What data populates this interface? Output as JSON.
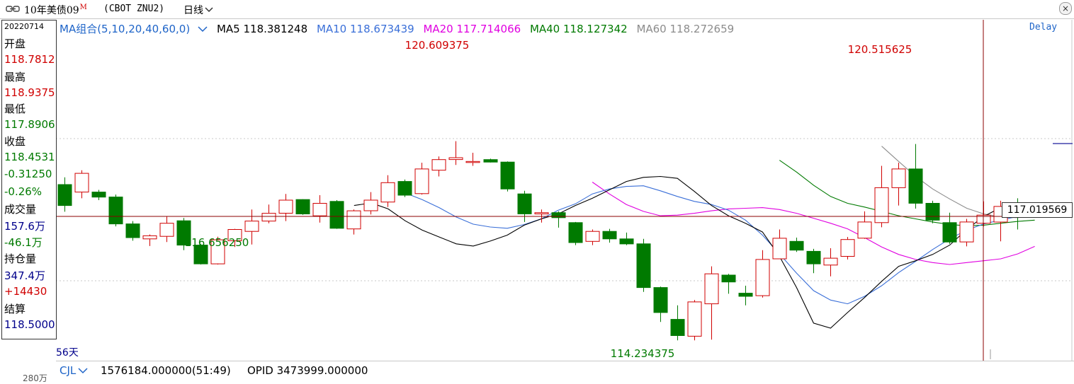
{
  "title_bar": {
    "instrument": "10年美债09",
    "marker": "M",
    "exchange": "(CBOT ZNU2)",
    "period": "日线",
    "window_button": "×"
  },
  "side_panel": {
    "date": "20220714",
    "open_label": "开盘",
    "open": "118.7812",
    "high_label": "最高",
    "high": "118.9375",
    "low_label": "最低",
    "low": "117.8906",
    "close_label": "收盘",
    "close": "118.4531",
    "change": "-0.31250",
    "change_pct": "-0.26%",
    "volume_label": "成交量",
    "volume": "157.6万",
    "volume_change": "-46.1万",
    "oi_label": "持仓量",
    "oi": "347.4万",
    "oi_change": "+14430",
    "settle_label": "结算",
    "settle": "118.5000"
  },
  "days_label": "56天",
  "ma_legend": {
    "group": "MA组合(5,10,20,40,60,0)",
    "ma5": "MA5 118.381248",
    "ma10": "MA10 118.673439",
    "ma20": "MA20 117.714066",
    "ma40": "MA40 118.127342",
    "ma60": "MA60 118.272659"
  },
  "delay_label": "Delay",
  "price_tag": "117.019569",
  "annotations": {
    "high1": "120.609375",
    "high2": "120.515625",
    "low1": "116.656250",
    "low2": "114.234375"
  },
  "volume_bar": {
    "indicator": "CJL",
    "volume_text": "1576184.000000(51:49)",
    "opid_text": "OPID 3473999.000000",
    "axis_label": "280万"
  },
  "colors": {
    "up": "#d00000",
    "down": "#007a00",
    "ma5": "#000000",
    "ma10": "#3a6fd8",
    "ma20": "#e000e0",
    "ma40": "#007a00",
    "ma60": "#8c8c8c",
    "axis_blue": "#1e64c8",
    "crosshair": "#8b0000"
  },
  "chart_data": {
    "type": "candlestick",
    "ylim": [
      114.0,
      121.0
    ],
    "candles": [
      {
        "o": 119.22,
        "h": 119.45,
        "l": 118.35,
        "c": 118.55
      },
      {
        "o": 118.98,
        "h": 119.68,
        "l": 118.78,
        "c": 119.58
      },
      {
        "o": 118.98,
        "h": 119.05,
        "l": 118.72,
        "c": 118.82
      },
      {
        "o": 118.82,
        "h": 118.9,
        "l": 117.88,
        "c": 117.96
      },
      {
        "o": 117.96,
        "h": 118.05,
        "l": 117.42,
        "c": 117.52
      },
      {
        "o": 117.48,
        "h": 117.62,
        "l": 117.25,
        "c": 117.58
      },
      {
        "o": 117.56,
        "h": 118.2,
        "l": 117.38,
        "c": 117.98
      },
      {
        "o": 118.06,
        "h": 118.15,
        "l": 117.12,
        "c": 117.28
      },
      {
        "o": 117.28,
        "h": 117.32,
        "l": 116.66,
        "c": 116.68
      },
      {
        "o": 116.68,
        "h": 117.55,
        "l": 116.66,
        "c": 117.45
      },
      {
        "o": 117.42,
        "h": 117.8,
        "l": 117.22,
        "c": 117.78
      },
      {
        "o": 117.72,
        "h": 118.42,
        "l": 117.3,
        "c": 118.05
      },
      {
        "o": 118.05,
        "h": 118.58,
        "l": 117.98,
        "c": 118.3
      },
      {
        "o": 118.3,
        "h": 118.92,
        "l": 118.05,
        "c": 118.72
      },
      {
        "o": 118.74,
        "h": 118.75,
        "l": 118.25,
        "c": 118.28
      },
      {
        "o": 118.22,
        "h": 118.88,
        "l": 118.0,
        "c": 118.62
      },
      {
        "o": 118.68,
        "h": 118.72,
        "l": 117.8,
        "c": 117.82
      },
      {
        "o": 117.8,
        "h": 118.42,
        "l": 117.62,
        "c": 118.38
      },
      {
        "o": 118.38,
        "h": 118.98,
        "l": 118.26,
        "c": 118.72
      },
      {
        "o": 118.66,
        "h": 119.52,
        "l": 118.5,
        "c": 119.28
      },
      {
        "o": 119.32,
        "h": 119.38,
        "l": 118.82,
        "c": 118.88
      },
      {
        "o": 118.93,
        "h": 119.92,
        "l": 118.9,
        "c": 119.72
      },
      {
        "o": 119.68,
        "h": 120.12,
        "l": 119.48,
        "c": 120.02
      },
      {
        "o": 120.02,
        "h": 120.61,
        "l": 119.85,
        "c": 120.08
      },
      {
        "o": 119.96,
        "h": 120.24,
        "l": 119.82,
        "c": 119.96
      },
      {
        "o": 120.02,
        "h": 120.05,
        "l": 119.93,
        "c": 119.94
      },
      {
        "o": 119.94,
        "h": 119.96,
        "l": 119.0,
        "c": 119.08
      },
      {
        "o": 118.92,
        "h": 119.02,
        "l": 118.02,
        "c": 118.28
      },
      {
        "o": 118.28,
        "h": 118.42,
        "l": 118.0,
        "c": 118.32
      },
      {
        "o": 118.32,
        "h": 118.36,
        "l": 117.84,
        "c": 118.16
      },
      {
        "o": 118.0,
        "h": 118.02,
        "l": 117.28,
        "c": 117.36
      },
      {
        "o": 117.4,
        "h": 117.78,
        "l": 117.28,
        "c": 117.72
      },
      {
        "o": 117.72,
        "h": 117.8,
        "l": 117.36,
        "c": 117.48
      },
      {
        "o": 117.48,
        "h": 117.68,
        "l": 117.28,
        "c": 117.32
      },
      {
        "o": 117.32,
        "h": 117.48,
        "l": 115.78,
        "c": 115.92
      },
      {
        "o": 115.92,
        "h": 115.95,
        "l": 114.82,
        "c": 115.12
      },
      {
        "o": 114.9,
        "h": 115.35,
        "l": 114.23,
        "c": 114.38
      },
      {
        "o": 114.36,
        "h": 115.52,
        "l": 114.23,
        "c": 115.46
      },
      {
        "o": 115.4,
        "h": 116.6,
        "l": 114.25,
        "c": 116.36
      },
      {
        "o": 116.32,
        "h": 116.36,
        "l": 115.72,
        "c": 116.1
      },
      {
        "o": 115.74,
        "h": 115.98,
        "l": 115.35,
        "c": 115.64
      },
      {
        "o": 115.66,
        "h": 117.12,
        "l": 115.6,
        "c": 116.82
      },
      {
        "o": 116.84,
        "h": 117.78,
        "l": 116.84,
        "c": 117.5
      },
      {
        "o": 117.4,
        "h": 117.52,
        "l": 117.06,
        "c": 117.12
      },
      {
        "o": 117.08,
        "h": 117.16,
        "l": 116.38,
        "c": 116.68
      },
      {
        "o": 116.64,
        "h": 117.18,
        "l": 116.28,
        "c": 116.86
      },
      {
        "o": 116.92,
        "h": 117.54,
        "l": 116.82,
        "c": 117.46
      },
      {
        "o": 117.5,
        "h": 118.36,
        "l": 117.48,
        "c": 118.02
      },
      {
        "o": 118.0,
        "h": 119.82,
        "l": 117.85,
        "c": 119.12
      },
      {
        "o": 119.12,
        "h": 119.92,
        "l": 118.55,
        "c": 119.72
      },
      {
        "o": 119.72,
        "h": 120.52,
        "l": 118.45,
        "c": 118.62
      },
      {
        "o": 118.62,
        "h": 118.7,
        "l": 117.98,
        "c": 118.08
      },
      {
        "o": 118.0,
        "h": 118.32,
        "l": 117.32,
        "c": 117.38
      },
      {
        "o": 117.38,
        "h": 118.12,
        "l": 117.24,
        "c": 118.02
      },
      {
        "o": 117.98,
        "h": 118.68,
        "l": 117.88,
        "c": 118.24
      },
      {
        "o": 118.02,
        "h": 118.7,
        "l": 117.4,
        "c": 118.52
      },
      {
        "o": 118.62,
        "h": 118.78,
        "l": 117.78,
        "c": 118.32
      },
      {
        "o": 118.32,
        "h": 118.52,
        "l": 118.18,
        "c": 118.5
      }
    ],
    "ma": {
      "ma5": [
        118.55,
        118.63,
        118.44,
        118.06,
        117.76,
        117.54,
        117.32,
        117.25,
        117.41,
        117.6,
        117.92,
        118.12,
        118.28,
        118.55,
        118.78,
        119.05,
        119.32,
        119.45,
        119.48,
        119.42,
        119.0,
        118.55,
        118.22,
        117.98,
        117.7,
        116.92,
        115.92,
        114.78,
        114.62,
        115.12,
        115.6,
        116.12,
        116.6,
        116.78,
        116.98,
        117.28,
        117.78,
        118.2,
        118.48,
        118.35,
        118.28
      ],
      "ma10": [
        118.95,
        118.74,
        118.48,
        118.18,
        117.95,
        117.86,
        117.82,
        117.94,
        118.12,
        118.4,
        118.6,
        118.92,
        119.08,
        119.16,
        119.18,
        119.02,
        118.84,
        118.68,
        118.58,
        118.4,
        118.08,
        117.6,
        117.0,
        116.38,
        115.82,
        115.52,
        115.4,
        115.64,
        115.98,
        116.4,
        116.76,
        117.14,
        117.48,
        117.76,
        117.96,
        118.08,
        118.2,
        118.34
      ],
      "ma20": [
        119.3,
        118.92,
        118.58,
        118.36,
        118.22,
        118.24,
        118.3,
        118.38,
        118.44,
        118.46,
        118.48,
        118.42,
        118.3,
        118.14,
        117.98,
        117.8,
        117.52,
        117.22,
        116.98,
        116.82,
        116.72,
        116.66,
        116.72,
        116.78,
        116.84,
        117.0,
        117.24
      ],
      "ma40": [
        120.0,
        119.62,
        119.2,
        118.84,
        118.62,
        118.5,
        118.36,
        118.22,
        118.12,
        118.02,
        117.94,
        117.9,
        117.92,
        117.98,
        118.04,
        118.08
      ],
      "ma60": [
        120.45,
        119.96,
        119.48,
        119.08,
        118.76,
        118.46,
        118.28,
        118.18,
        118.16,
        118.24
      ]
    }
  }
}
